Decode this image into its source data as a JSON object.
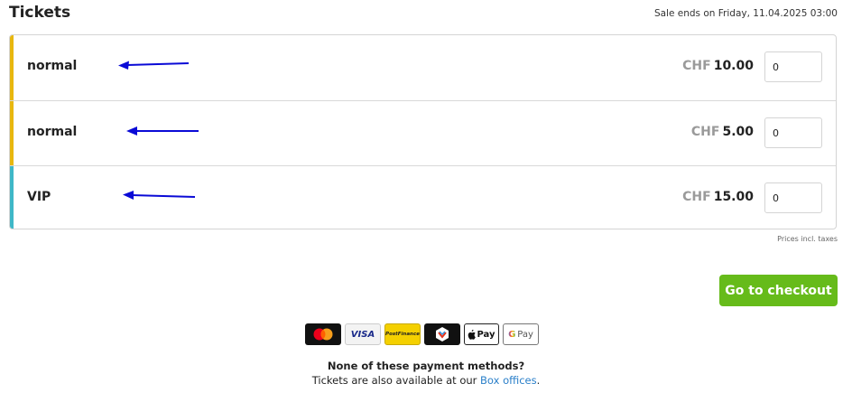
{
  "header": {
    "title": "Tickets",
    "sale_ends": "Sale ends on Friday, 11.04.2025 03:00"
  },
  "tickets": [
    {
      "name": "normal",
      "currency": "CHF",
      "amount": "10.00",
      "quantity": "0",
      "bar_color": "#e8b70f"
    },
    {
      "name": "normal",
      "currency": "CHF",
      "amount": "5.00",
      "quantity": "0",
      "bar_color": "#e8b70f"
    },
    {
      "name": "VIP",
      "currency": "CHF",
      "amount": "15.00",
      "quantity": "0",
      "bar_color": "#3fb7c7"
    }
  ],
  "prices_note": "Prices incl. taxes",
  "checkout": {
    "label": "Go to checkout",
    "color": "#66bb1a"
  },
  "payment_methods": [
    {
      "name": "mastercard-icon"
    },
    {
      "name": "visa-icon",
      "label": "VISA"
    },
    {
      "name": "postfinance-icon",
      "label": "PostFinance"
    },
    {
      "name": "twint-icon"
    },
    {
      "name": "apple-pay-icon",
      "label": "Pay"
    },
    {
      "name": "google-pay-icon",
      "label": "Pay"
    }
  ],
  "footer": {
    "question": "None of these payment methods?",
    "text_before": "Tickets are also available at our ",
    "link": "Box offices",
    "text_after": "."
  },
  "colors": {
    "arrow": "#0a0ad6",
    "link": "#2a7fc9"
  }
}
